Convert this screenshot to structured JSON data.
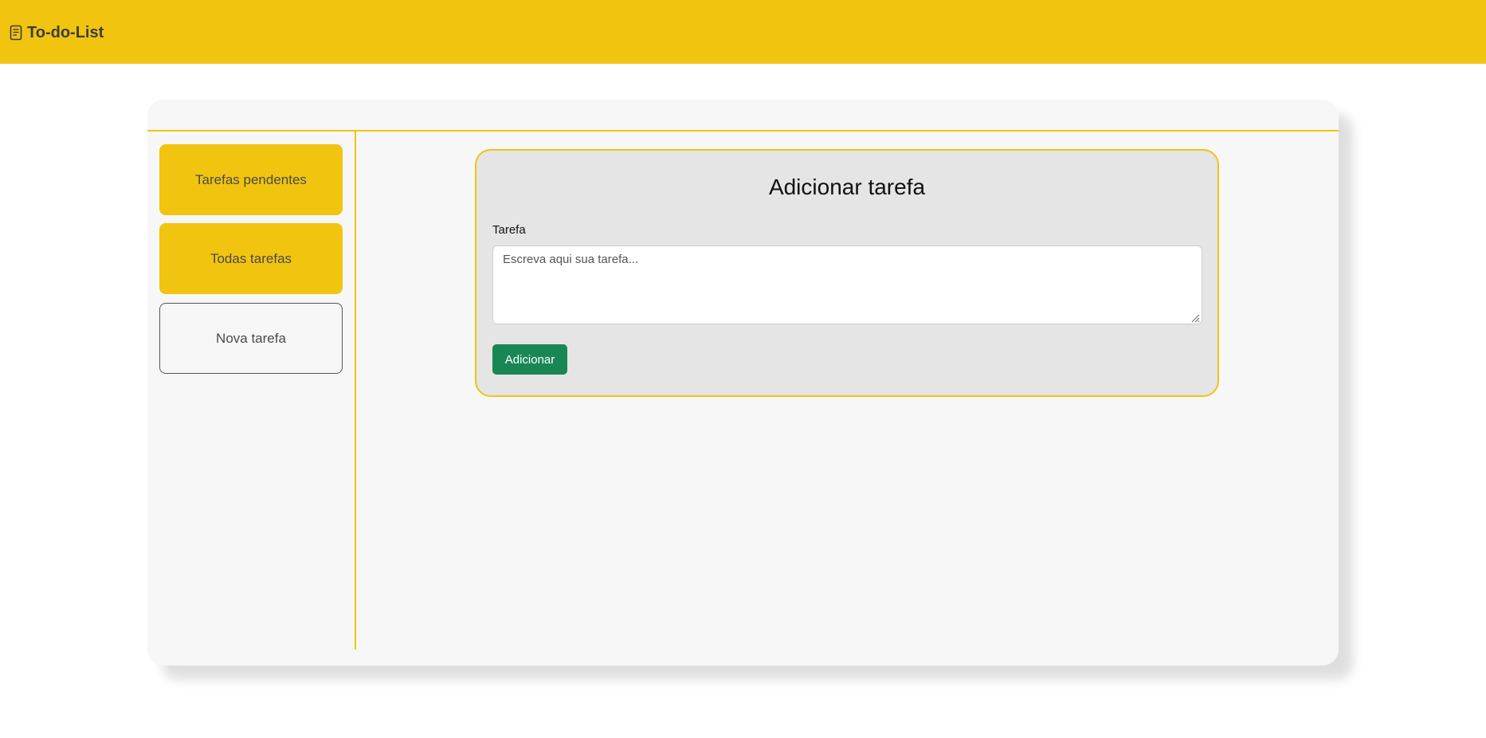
{
  "header": {
    "brand_icon": "document-icon",
    "brand_title": "To-do-List"
  },
  "sidebar": {
    "items": [
      {
        "label": "Tarefas pendentes",
        "style": "filled"
      },
      {
        "label": "Todas tarefas",
        "style": "filled"
      },
      {
        "label": "Nova tarefa",
        "style": "outline"
      }
    ]
  },
  "form": {
    "title": "Adicionar tarefa",
    "field_label": "Tarefa",
    "task_value": "",
    "task_placeholder": "Escreva aqui sua tarefa...",
    "submit_label": "Adicionar"
  },
  "colors": {
    "accent": "#f1c40f",
    "submit": "#198754",
    "panel": "#f7f7f7",
    "card": "#e5e5e5"
  }
}
